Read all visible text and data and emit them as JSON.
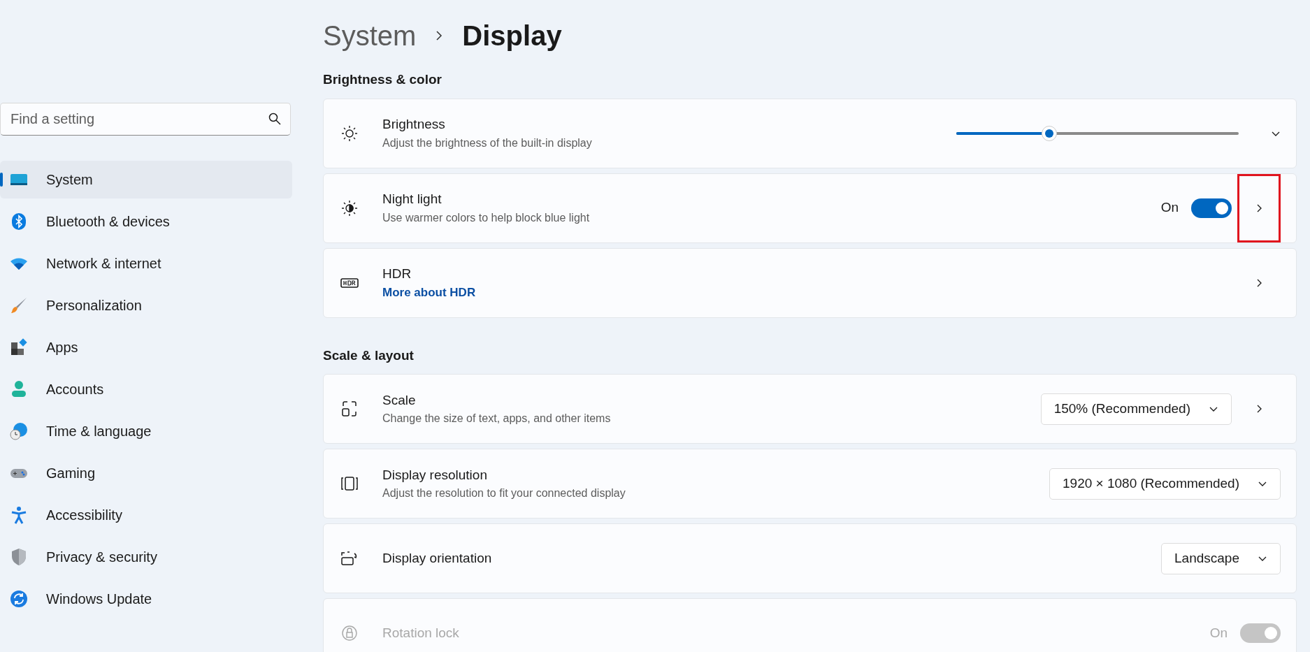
{
  "search": {
    "placeholder": "Find a setting"
  },
  "sidebar": {
    "items": [
      {
        "label": "System",
        "selected": true
      },
      {
        "label": "Bluetooth & devices",
        "selected": false
      },
      {
        "label": "Network & internet",
        "selected": false
      },
      {
        "label": "Personalization",
        "selected": false
      },
      {
        "label": "Apps",
        "selected": false
      },
      {
        "label": "Accounts",
        "selected": false
      },
      {
        "label": "Time & language",
        "selected": false
      },
      {
        "label": "Gaming",
        "selected": false
      },
      {
        "label": "Accessibility",
        "selected": false
      },
      {
        "label": "Privacy & security",
        "selected": false
      },
      {
        "label": "Windows Update",
        "selected": false
      }
    ]
  },
  "breadcrumb": {
    "parent": "System",
    "current": "Display"
  },
  "sections": [
    {
      "title": "Brightness & color",
      "cards": [
        {
          "kind": "expander",
          "title": "Brightness",
          "subtitle": "Adjust the brightness of the built-in display",
          "control": {
            "kind": "slider",
            "level": 0.33
          },
          "disabled": false
        },
        {
          "kind": "navigation",
          "title": "Night light",
          "subtitle": "Use warmer colors to help block blue light",
          "control": {
            "kind": "toggle",
            "label": "On",
            "on": true
          },
          "highlighted": true,
          "disabled": false
        },
        {
          "kind": "navigation",
          "title": "HDR",
          "link": "More about HDR",
          "disabled": false
        }
      ]
    },
    {
      "title": "Scale & layout",
      "cards": [
        {
          "kind": "navigation",
          "title": "Scale",
          "subtitle": "Change the size of text, apps, and other items",
          "control": {
            "kind": "dropdown",
            "value": "150% (Recommended)"
          },
          "disabled": false
        },
        {
          "kind": "plain",
          "title": "Display resolution",
          "subtitle": "Adjust the resolution to fit your connected display",
          "control": {
            "kind": "dropdown",
            "value": "1920 × 1080 (Recommended)"
          },
          "disabled": false
        },
        {
          "kind": "plain",
          "title": "Display orientation",
          "control": {
            "kind": "dropdown",
            "value": "Landscape"
          },
          "disabled": false
        },
        {
          "kind": "plain",
          "title": "Rotation lock",
          "control": {
            "kind": "toggle",
            "label": "On",
            "on": true
          },
          "disabled": true
        }
      ]
    }
  ]
}
